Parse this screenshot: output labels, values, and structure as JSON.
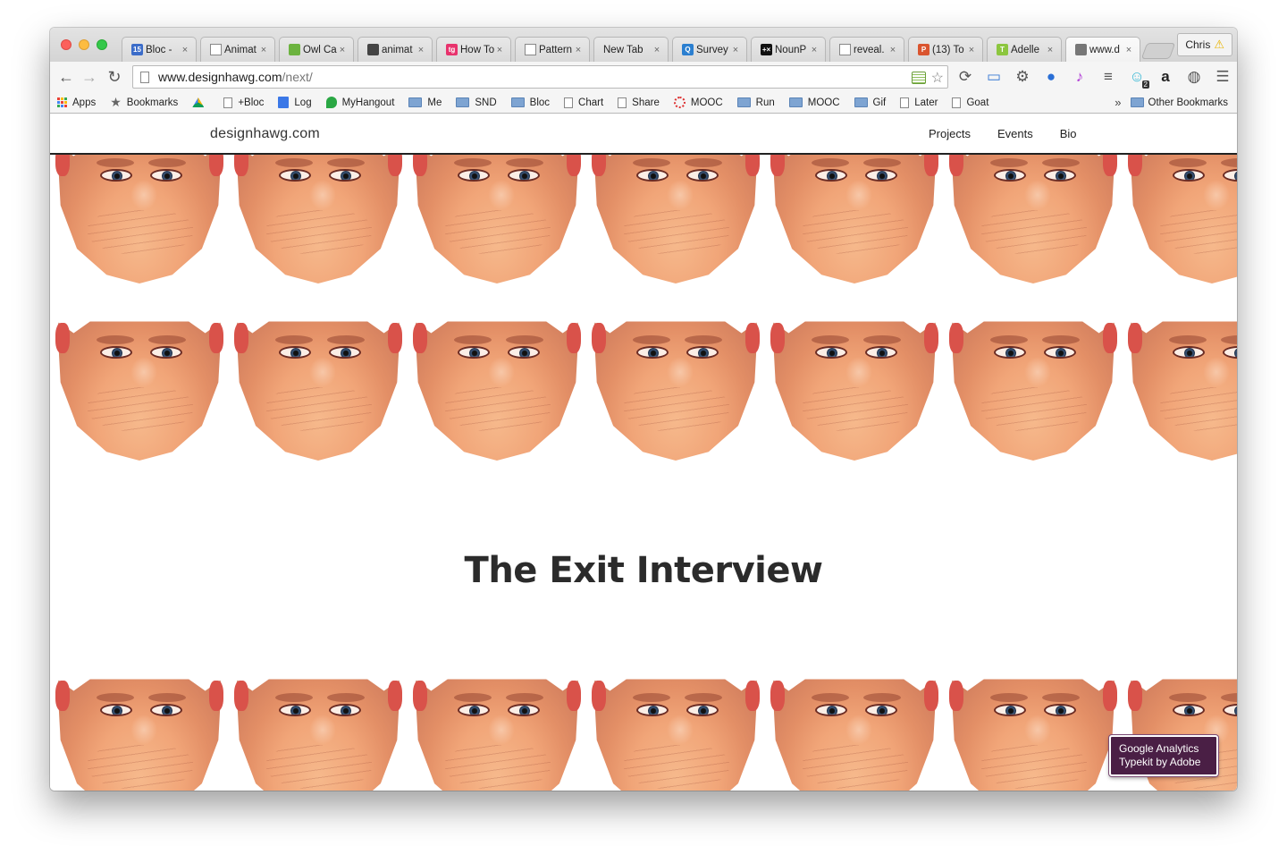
{
  "browser": {
    "tabs": [
      {
        "title": "Bloc -",
        "favicon": "calendar-15-icon",
        "fav_color": "#3b6cc9",
        "fav_text": "15"
      },
      {
        "title": "Animat",
        "favicon": "page-icon"
      },
      {
        "title": "Owl Ca",
        "favicon": "owl-icon",
        "fav_color": "#6cb33f",
        "fav_text": ""
      },
      {
        "title": "animat",
        "favicon": "film-icon",
        "fav_color": "#444",
        "fav_text": ""
      },
      {
        "title": "How To",
        "favicon": "tg-icon",
        "fav_color": "#e8336d",
        "fav_text": "tg"
      },
      {
        "title": "Pattern",
        "favicon": "page-icon"
      },
      {
        "title": "New Tab",
        "favicon": "none"
      },
      {
        "title": "Survey",
        "favicon": "survey-icon",
        "fav_color": "#2b7fd0",
        "fav_text": "Q"
      },
      {
        "title": "NounP",
        "favicon": "nounproject-icon",
        "fav_color": "#111",
        "fav_text": "+×"
      },
      {
        "title": "reveal.",
        "favicon": "page-icon"
      },
      {
        "title": "(13) To",
        "favicon": "producthunt-icon",
        "fav_color": "#da552f",
        "fav_text": "P"
      },
      {
        "title": "Adelle",
        "favicon": "typekit-icon",
        "fav_color": "#8cc63f",
        "fav_text": "T"
      },
      {
        "title": "www.d",
        "favicon": "designhawg-icon",
        "fav_color": "#777",
        "fav_text": "",
        "active": true
      }
    ],
    "profile_name": "Chris",
    "url_host": "www.designhawg.com",
    "url_path": "/next/",
    "bookmarks": [
      {
        "label": "Apps",
        "icon": "apps-grid-icon"
      },
      {
        "label": "Bookmarks",
        "icon": "star-icon"
      },
      {
        "label": "",
        "icon": "drive-icon"
      },
      {
        "label": "+Bloc",
        "icon": "page-icon"
      },
      {
        "label": "Log",
        "icon": "doc-icon"
      },
      {
        "label": "MyHangout",
        "icon": "hangout-icon"
      },
      {
        "label": "Me",
        "icon": "folder-icon"
      },
      {
        "label": "SND",
        "icon": "folder-icon"
      },
      {
        "label": "Bloc",
        "icon": "folder-icon"
      },
      {
        "label": "Chart",
        "icon": "page-icon"
      },
      {
        "label": "Share",
        "icon": "page-icon"
      },
      {
        "label": "MOOC",
        "icon": "mooc-icon"
      },
      {
        "label": "Run",
        "icon": "folder-icon"
      },
      {
        "label": "MOOC",
        "icon": "folder-icon"
      },
      {
        "label": "Gif",
        "icon": "folder-icon"
      },
      {
        "label": "Later",
        "icon": "page-icon"
      },
      {
        "label": "Goat",
        "icon": "page-icon"
      }
    ],
    "bookmarks_overflow": "»",
    "other_bookmarks": "Other Bookmarks",
    "extension_badge": "2"
  },
  "site": {
    "logo": "designhawg.com",
    "nav": [
      "Projects",
      "Events",
      "Bio"
    ],
    "title": "The Exit Interview",
    "badge_line1": "Google Analytics",
    "badge_line2": "Typekit by Adobe"
  },
  "colors": {
    "title_text": "#2b2b2b",
    "badge_bg": "#4a1f45",
    "header_rule": "#222222"
  }
}
